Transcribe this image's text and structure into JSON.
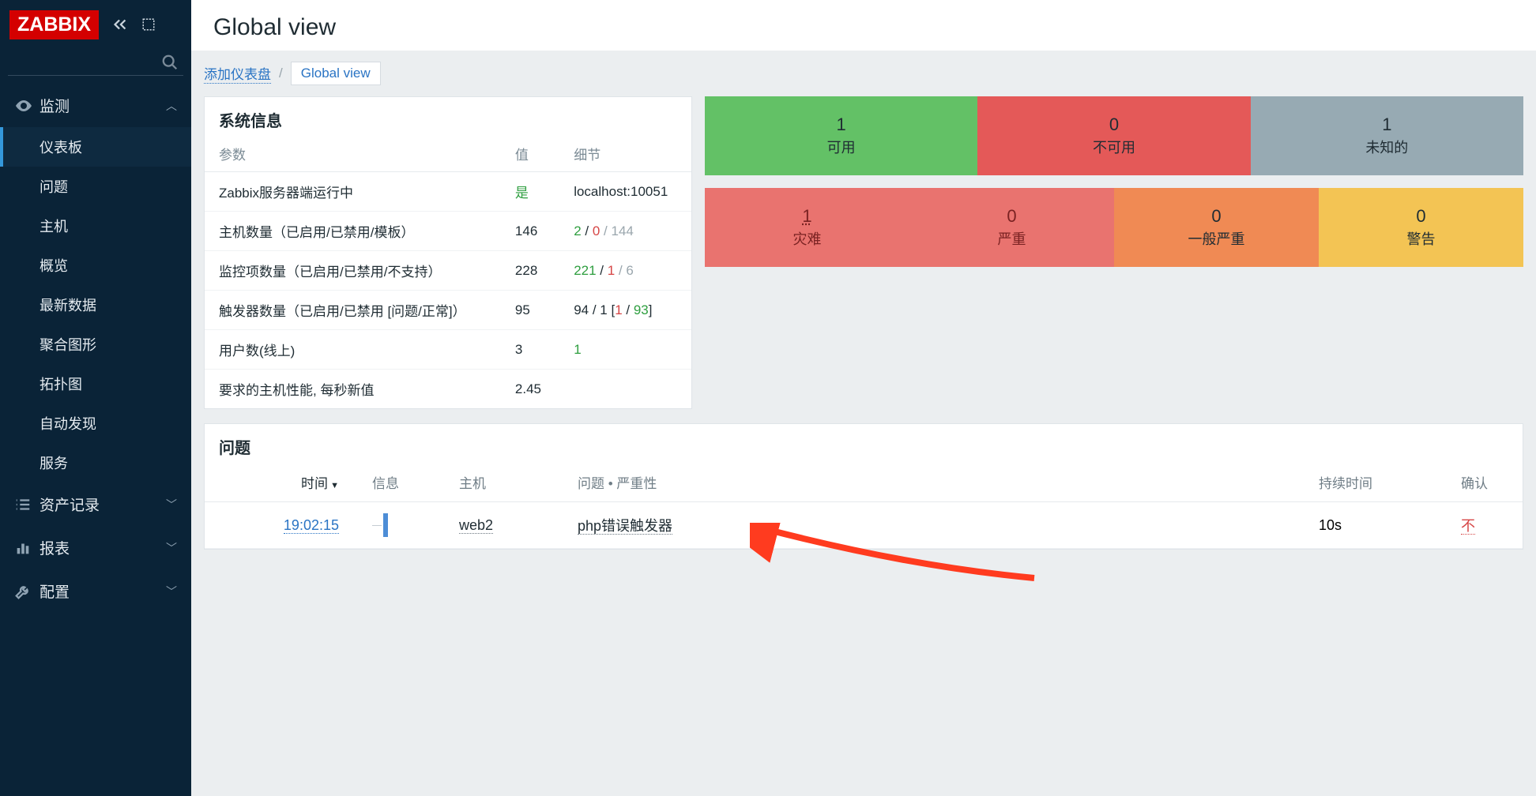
{
  "logo": "ZABBIX",
  "page_title": "Global view",
  "breadcrumb": {
    "add": "添加仪表盘",
    "current": "Global view"
  },
  "sidebar": {
    "sections": [
      {
        "icon": "eye",
        "label": "监测",
        "expanded": true,
        "items": [
          {
            "label": "仪表板",
            "active": true
          },
          {
            "label": "问题"
          },
          {
            "label": "主机"
          },
          {
            "label": "概览"
          },
          {
            "label": "最新数据"
          },
          {
            "label": "聚合图形"
          },
          {
            "label": "拓扑图"
          },
          {
            "label": "自动发现"
          },
          {
            "label": "服务"
          }
        ]
      },
      {
        "icon": "list",
        "label": "资产记录",
        "expanded": false
      },
      {
        "icon": "bar",
        "label": "报表",
        "expanded": false
      },
      {
        "icon": "wrench",
        "label": "配置",
        "expanded": false
      }
    ]
  },
  "sysinfo": {
    "title": "系统信息",
    "headers": {
      "param": "参数",
      "value": "值",
      "detail": "细节"
    },
    "rows": [
      {
        "param": "Zabbix服务器端运行中",
        "value_html": [
          [
            "是",
            "green"
          ]
        ],
        "detail_html": [
          [
            "localhost:10051",
            "plain"
          ]
        ]
      },
      {
        "param": "主机数量（已启用/已禁用/模板）",
        "value_html": [
          [
            "146",
            "plain"
          ]
        ],
        "detail_html": [
          [
            "2",
            "green"
          ],
          [
            " / ",
            "plain"
          ],
          [
            "0",
            "red"
          ],
          [
            " / ",
            "gray"
          ],
          [
            "144",
            "gray"
          ]
        ]
      },
      {
        "param": "监控项数量（已启用/已禁用/不支持）",
        "value_html": [
          [
            "228",
            "plain"
          ]
        ],
        "detail_html": [
          [
            "221",
            "green"
          ],
          [
            " / ",
            "plain"
          ],
          [
            "1",
            "red"
          ],
          [
            " / ",
            "gray"
          ],
          [
            "6",
            "gray"
          ]
        ]
      },
      {
        "param": "触发器数量（已启用/已禁用 [问题/正常]）",
        "value_html": [
          [
            "95",
            "plain"
          ]
        ],
        "detail_html": [
          [
            "94 / 1 [",
            "plain"
          ],
          [
            "1",
            "red"
          ],
          [
            " / ",
            "plain"
          ],
          [
            "93",
            "green"
          ],
          [
            "]",
            "plain"
          ]
        ]
      },
      {
        "param": "用户数(线上)",
        "value_html": [
          [
            "3",
            "plain"
          ]
        ],
        "detail_html": [
          [
            "1",
            "green"
          ]
        ]
      },
      {
        "param": "要求的主机性能, 每秒新值",
        "value_html": [
          [
            "2.45",
            "plain"
          ]
        ],
        "detail_html": []
      }
    ]
  },
  "tiles_top": [
    {
      "value": "1",
      "label": "可用",
      "cls": "t-green"
    },
    {
      "value": "0",
      "label": "不可用",
      "cls": "t-red"
    },
    {
      "value": "1",
      "label": "未知的",
      "cls": "t-gray"
    }
  ],
  "tiles_bottom": [
    {
      "value": "1",
      "label": "灾难",
      "cls": "t-red2",
      "u": true
    },
    {
      "value": "0",
      "label": "严重",
      "cls": "t-red2"
    },
    {
      "value": "0",
      "label": "一般严重",
      "cls": "t-orange"
    },
    {
      "value": "0",
      "label": "警告",
      "cls": "t-yellow"
    }
  ],
  "problems": {
    "title": "问题",
    "headers": {
      "time": "时间",
      "info": "信息",
      "host": "主机",
      "problem": "问题 • 严重性",
      "duration": "持续时间",
      "ack": "确认"
    },
    "rows": [
      {
        "time": "19:02:15",
        "host": "web2",
        "problem": "php错误触发器",
        "duration": "10s",
        "ack": "不"
      }
    ]
  }
}
